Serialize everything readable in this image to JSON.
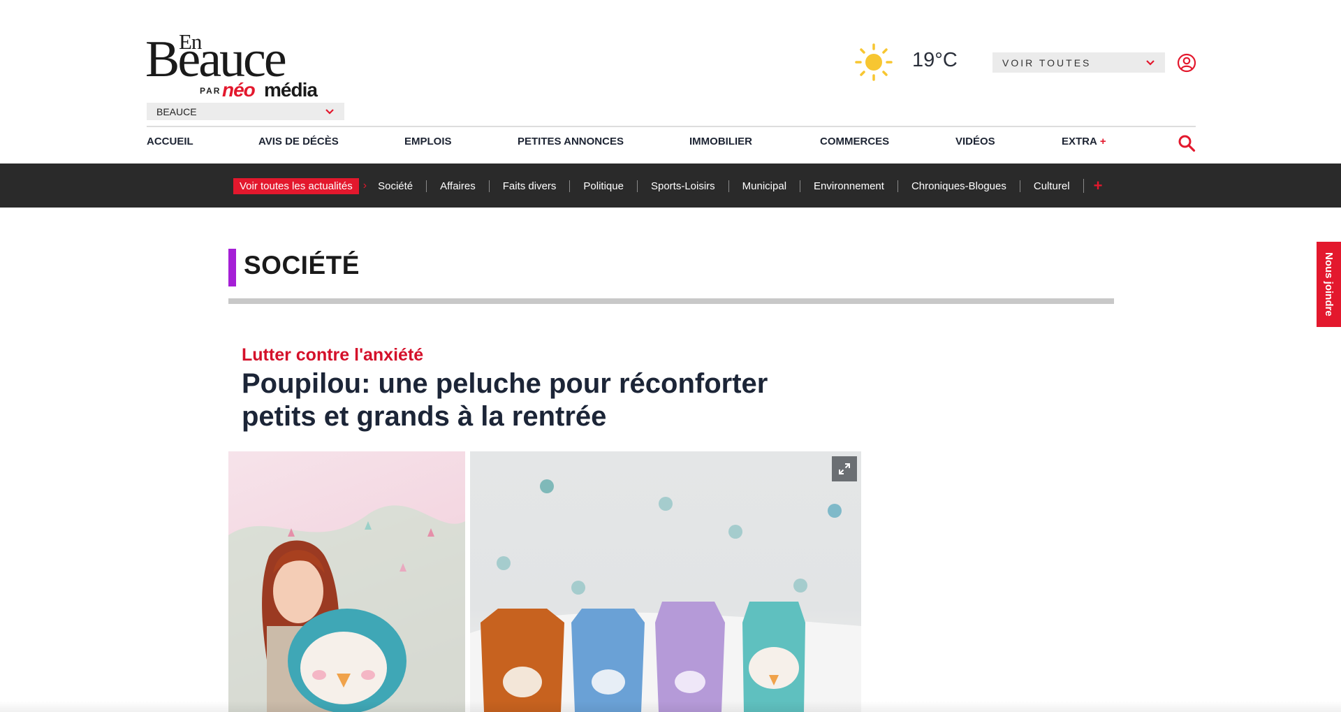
{
  "logo": {
    "en": "En",
    "beauce": "Beauce",
    "par": "PAR",
    "neo": "néo",
    "media": "média"
  },
  "region": {
    "selected": "BEAUCE"
  },
  "weather": {
    "temperature": "19°C",
    "icon": "sun-icon"
  },
  "regions_dropdown": {
    "label": "VOIR TOUTES"
  },
  "main_nav": [
    "ACCUEIL",
    "AVIS DE DÉCÈS",
    "EMPLOIS",
    "PETITES ANNONCES",
    "IMMOBILIER",
    "COMMERCES",
    "VIDÉOS",
    "EXTRA"
  ],
  "main_nav_extra_plus": "+",
  "subnav": {
    "cta": "Voir toutes les actualités",
    "items": [
      "Société",
      "Affaires",
      "Faits divers",
      "Politique",
      "Sports-Loisirs",
      "Municipal",
      "Environnement",
      "Chroniques-Blogues",
      "Culturel"
    ],
    "more": "+"
  },
  "section": {
    "title": "SOCIÉTÉ",
    "accent_color": "#a51fd6"
  },
  "article": {
    "kicker": "Lutter contre l'anxiété",
    "headline": "Poupilou: une peluche pour réconforter petits et grands à la rentrée"
  },
  "side_tab": {
    "label": "Nous joindre"
  },
  "colors": {
    "brand_red": "#e3182d",
    "subnav_bg": "#2a2a2a",
    "text_dark": "#1c2537"
  }
}
